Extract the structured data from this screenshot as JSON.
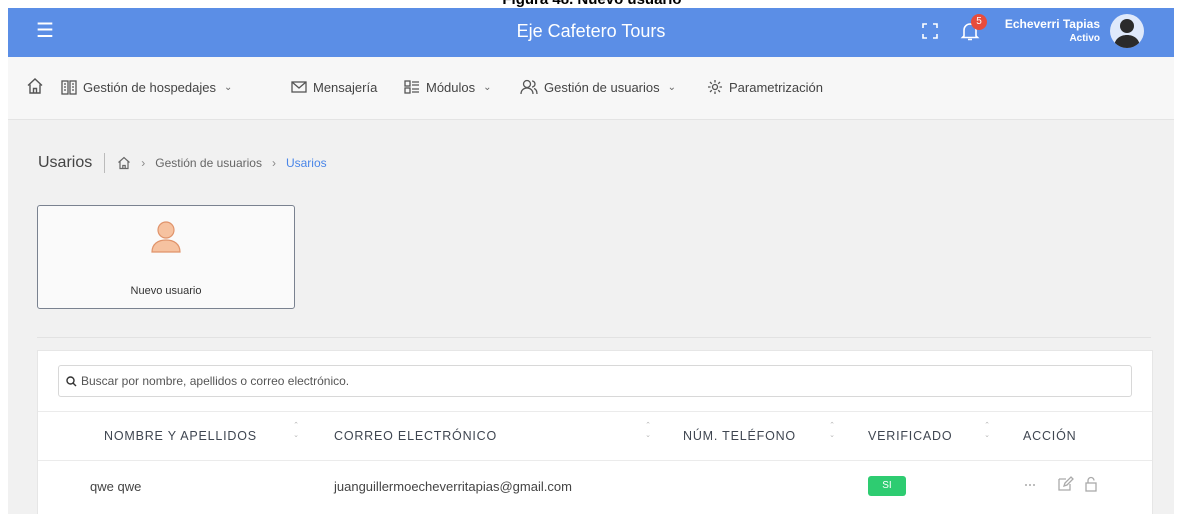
{
  "caption": "Figura 48. Nuevo usuario",
  "header": {
    "app_title": "Eje Cafetero Tours",
    "notification_count": "5",
    "user_name": "Echeverri Tapias",
    "user_status": "Activo"
  },
  "nav": {
    "items": [
      {
        "label": "Gestión de hospedajes",
        "icon": "building-icon",
        "has_dropdown": true
      },
      {
        "label": "Mensajería",
        "icon": "mail-icon",
        "has_dropdown": false
      },
      {
        "label": "Módulos",
        "icon": "modules-icon",
        "has_dropdown": true
      },
      {
        "label": "Gestión de usuarios",
        "icon": "users-icon",
        "has_dropdown": true
      },
      {
        "label": "Parametrización",
        "icon": "gear-icon",
        "has_dropdown": false
      }
    ],
    "dropdown_glyph": "⌄"
  },
  "breadcrumb": {
    "title": "Usarios",
    "items": [
      "Gestión de usuarios",
      "Usarios"
    ],
    "separator": "›"
  },
  "card": {
    "label": "Nuevo usuario"
  },
  "search": {
    "placeholder": "Buscar por nombre, apellidos o correo electrónico."
  },
  "table": {
    "columns": [
      "NOMBRE Y APELLIDOS",
      "CORREO ELECTRÓNICO",
      "NÚM. TELÉFONO",
      "VERIFICADO",
      "ACCIÓN"
    ],
    "rows": [
      {
        "name": "qwe qwe",
        "email": "juanguillermoecheverritapias@gmail.com",
        "phone": "",
        "verified": "SI"
      }
    ]
  },
  "colors": {
    "topbar": "#5b8ee6",
    "accent": "#4a86e8",
    "verified": "#2ecc71",
    "badge": "#e74c3c"
  }
}
